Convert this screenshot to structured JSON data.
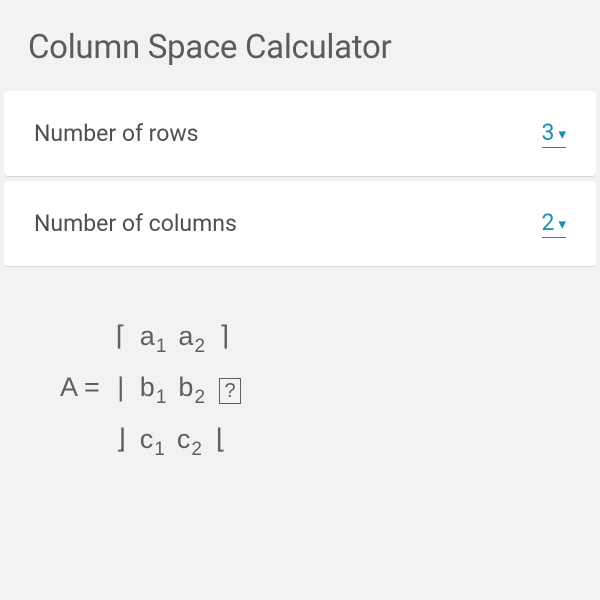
{
  "header": {
    "title": "Column Space Calculator"
  },
  "inputs": {
    "rows": {
      "label": "Number of rows",
      "value": "3"
    },
    "columns": {
      "label": "Number of columns",
      "value": "2"
    }
  },
  "matrix": {
    "lhs": "A =",
    "brackets": {
      "topLeft": "⌈",
      "topRight": "⌉",
      "midLeft": "|",
      "midRight": "",
      "botLeft": "⌋",
      "botRight": "⌊"
    },
    "rows": [
      {
        "elems": [
          {
            "base": "a",
            "sub": "1"
          },
          {
            "base": "a",
            "sub": "2"
          }
        ]
      },
      {
        "elems": [
          {
            "base": "b",
            "sub": "1"
          },
          {
            "base": "b",
            "sub": "2"
          }
        ]
      },
      {
        "elems": [
          {
            "base": "c",
            "sub": "1"
          },
          {
            "base": "c",
            "sub": "2"
          }
        ]
      }
    ],
    "helpGlyph": "?"
  }
}
